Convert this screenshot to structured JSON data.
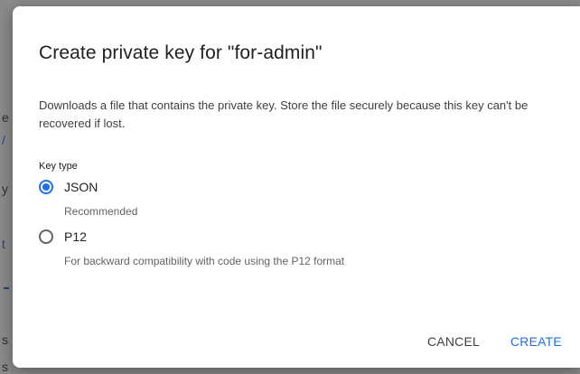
{
  "background": {
    "glyphs": [
      "e",
      "/",
      "y",
      "t",
      "s",
      "s"
    ]
  },
  "dialog": {
    "title": "Create private key for \"for-admin\"",
    "description": "Downloads a file that contains the private key. Store the file securely because this key can't be recovered if lost.",
    "key_type_label": "Key type",
    "options": [
      {
        "label": "JSON",
        "help": "Recommended",
        "selected": true
      },
      {
        "label": "P12",
        "help": "For backward compatibility with code using the P12 format",
        "selected": false
      }
    ],
    "cancel_label": "CANCEL",
    "create_label": "CREATE"
  },
  "colors": {
    "accent": "#1a73e8",
    "text_primary": "#202124",
    "text_secondary": "#5f6368",
    "scrim": "#8a8a8a"
  }
}
